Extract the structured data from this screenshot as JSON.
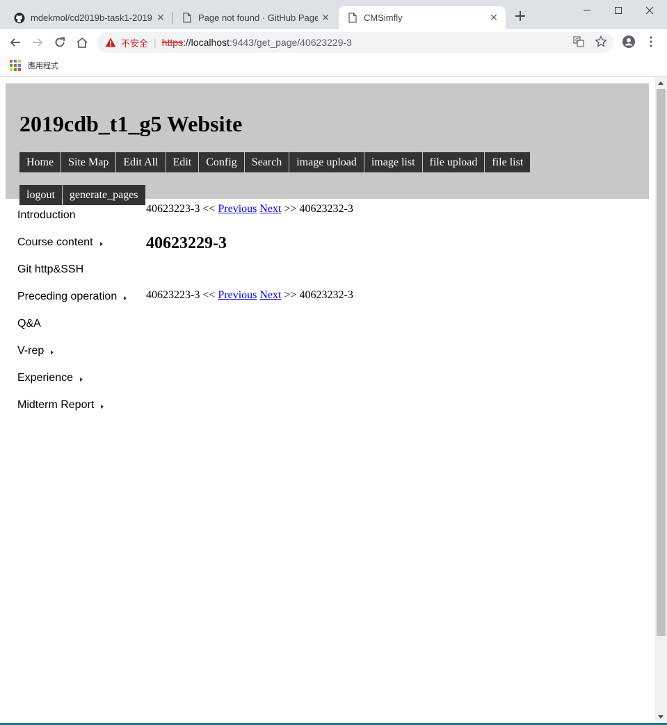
{
  "browser": {
    "tabs": [
      {
        "title": "mdekmol/cd2019b-task1-2019",
        "icon": "github-icon",
        "active": false
      },
      {
        "title": "Page not found · GitHub Pages",
        "icon": "document-icon",
        "active": false
      },
      {
        "title": "CMSimfly",
        "icon": "document-icon",
        "active": true
      }
    ],
    "address": {
      "security_label": "不安全",
      "scheme": "https",
      "host": "://localhost",
      "path": ":9443/get_page/40623229-3"
    },
    "bookmarks": {
      "apps_label": "應用程式"
    }
  },
  "site": {
    "title": "2019cdb_t1_g5 Website",
    "menu_row1": [
      "Home",
      "Site Map",
      "Edit All",
      "Edit",
      "Config",
      "Search",
      "image upload",
      "image list",
      "file upload",
      "file list"
    ],
    "menu_row2": [
      "logout",
      "generate_pages"
    ]
  },
  "sidebar": {
    "items": [
      {
        "label": "Introduction",
        "has_submenu": false
      },
      {
        "label": "Course content",
        "has_submenu": true
      },
      {
        "label": "Git http&SSH",
        "has_submenu": false
      },
      {
        "label": "Preceding operation",
        "has_submenu": true
      },
      {
        "label": "Q&A",
        "has_submenu": false
      },
      {
        "label": "V-rep",
        "has_submenu": true
      },
      {
        "label": "Experience",
        "has_submenu": true
      },
      {
        "label": "Midterm Report",
        "has_submenu": true
      }
    ]
  },
  "content": {
    "pager": {
      "prev_page": "40623223-3",
      "prev_arrow": "<<",
      "previous_label": "Previous",
      "next_label": "Next",
      "next_arrow": ">>",
      "next_page": "40623232-3"
    },
    "heading": "40623229-3"
  },
  "colors": {
    "header_bg": "#c8c8c8",
    "menu_bg": "#333333",
    "link": "#0000ee",
    "insecure": "#c5221f"
  }
}
